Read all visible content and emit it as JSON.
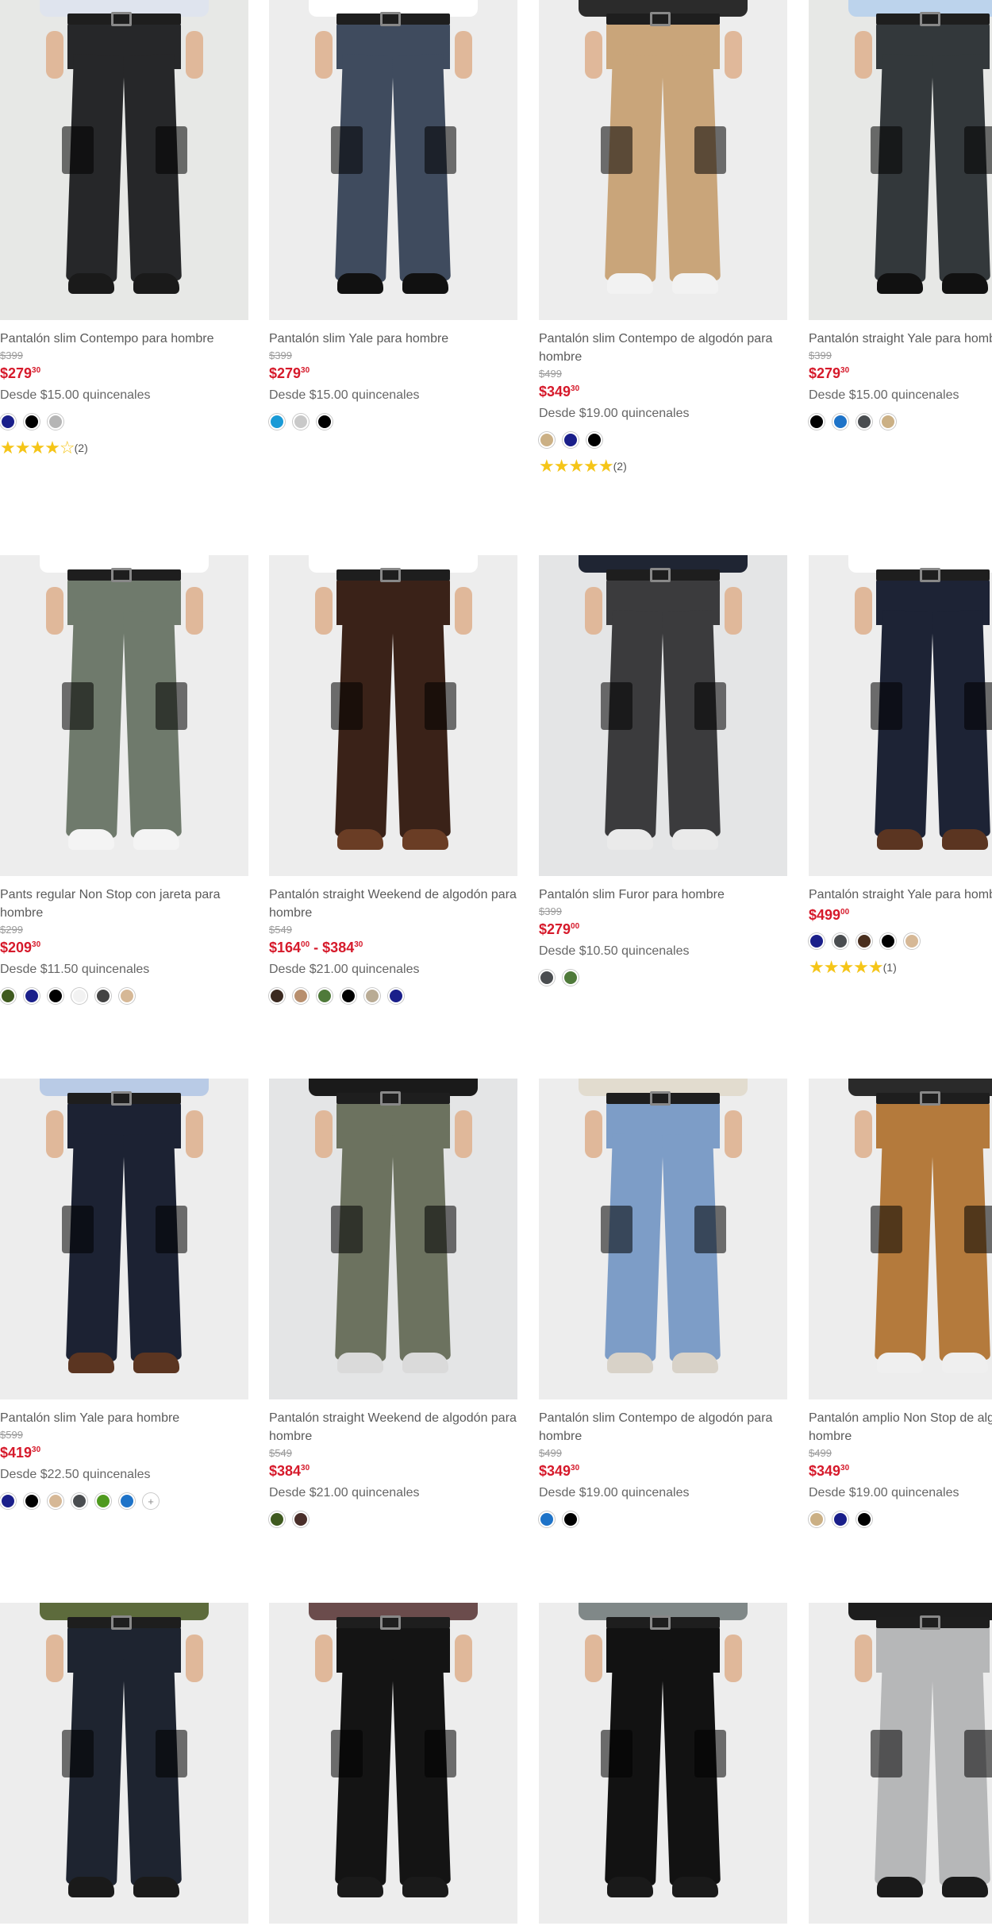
{
  "products": [
    {
      "title": "Pantalón slim Contempo para hombre",
      "old": "$399",
      "price": "$279",
      "cents": "30",
      "quin": "Desde $15.00 quincenales",
      "swatches": [
        "#1a1f8a",
        "#000000",
        "#b5b5b5"
      ],
      "stars": "★★★★☆",
      "reviews": "(2)",
      "pants": "#262729",
      "shirt": "#dfe4ee",
      "shoe": "#1a1a1a",
      "bg": "bg1"
    },
    {
      "title": "Pantalón slim Yale para hombre",
      "old": "$399",
      "price": "$279",
      "cents": "30",
      "quin": "Desde $15.00 quincenales",
      "swatches": [
        "#1a9ad6",
        "#c9c9c9",
        "#000000"
      ],
      "stars": "",
      "reviews": "",
      "pants": "#3f4b5e",
      "shirt": "#ffffff",
      "shoe": "#111111",
      "bg": "bg2"
    },
    {
      "title": "Pantalón slim Contempo de algodón para hombre",
      "old": "$499",
      "price": "$349",
      "cents": "30",
      "quin": "Desde $19.00 quincenales",
      "swatches": [
        "#cbb085",
        "#1a1f8a",
        "#000000"
      ],
      "stars": "★★★★★",
      "reviews": "(2)",
      "pants": "#c9a57a",
      "shirt": "#2b2b2b",
      "shoe": "#f2f2f2",
      "bg": "bg2"
    },
    {
      "title": "Pantalón straight Yale para hombre",
      "old": "$399",
      "price": "$279",
      "cents": "30",
      "quin": "Desde $15.00 quincenales",
      "swatches": [
        "#000000",
        "#1e73c8",
        "#4a4d50",
        "#cbb085"
      ],
      "stars": "",
      "reviews": "",
      "pants": "#33383b",
      "shirt": "#bcd3ec",
      "shoe": "#111111",
      "bg": "bg1"
    },
    {
      "title": "Pants regular Non Stop con jareta para hombre",
      "old": "$299",
      "price": "$209",
      "cents": "30",
      "quin": "Desde $11.50 quincenales",
      "swatches": [
        "#3f5a1f",
        "#1a1f8a",
        "#000000",
        "#f2f2f2",
        "#444444",
        "#d6b896"
      ],
      "stars": "",
      "reviews": "",
      "pants": "#6f7a6c",
      "shirt": "#ffffff",
      "shoe": "#f4f4f4",
      "bg": "bg2"
    },
    {
      "title": "Pantalón straight Weekend de algodón para hombre",
      "old": "$549",
      "price": "$164",
      "cents": "00",
      "range": " - $384",
      "rcents": "30",
      "quin": "Desde $21.00 quincenales",
      "swatches": [
        "#3b2a20",
        "#b88f6e",
        "#4f7a3a",
        "#000000",
        "#b9ab94",
        "#1a1f8a"
      ],
      "stars": "",
      "reviews": "",
      "pants": "#3a2218",
      "shirt": "#ffffff",
      "shoe": "#6a3d25",
      "bg": "bg2"
    },
    {
      "title": "Pantalón slim Furor para hombre",
      "old": "$399",
      "price": "$279",
      "cents": "00",
      "quin": "Desde $10.50 quincenales",
      "swatches": [
        "#4a4d50",
        "#4f7a3a"
      ],
      "stars": "",
      "reviews": "",
      "pants": "#3b3b3d",
      "shirt": "#1f2533",
      "shoe": "#eaeaea",
      "bg": "bg3"
    },
    {
      "title": "Pantalón straight Yale para hombre",
      "old": "",
      "price": "$499",
      "cents": "00",
      "quin": "",
      "swatches": [
        "#1a1f8a",
        "#4a4d50",
        "#4a2f1e",
        "#000000",
        "#d6b896"
      ],
      "stars": "★★★★★",
      "reviews": "(1)",
      "pants": "#1d2335",
      "shirt": "#ffffff",
      "shoe": "#5b3521",
      "bg": "bg2"
    },
    {
      "title": "Pantalón slim Yale para hombre",
      "old": "$599",
      "price": "$419",
      "cents": "30",
      "quin": "Desde $22.50 quincenales",
      "swatches": [
        "#1a1f8a",
        "#000000",
        "#d6b896",
        "#4a4d50",
        "#4f9a1f",
        "#1e73c8"
      ],
      "more": "+",
      "stars": "",
      "reviews": "",
      "pants": "#1c2233",
      "shirt": "#b9cbe6",
      "shoe": "#5b3521",
      "bg": "bg2"
    },
    {
      "title": "Pantalón straight Weekend de algodón para hombre",
      "old": "$549",
      "price": "$384",
      "cents": "30",
      "quin": "Desde $21.00 quincenales",
      "swatches": [
        "#3f5a1f",
        "#4a2f2a"
      ],
      "stars": "",
      "reviews": "",
      "pants": "#6c725f",
      "shirt": "#1a1a1a",
      "shoe": "#dadada",
      "bg": "bg3"
    },
    {
      "title": "Pantalón slim Contempo de algodón para hombre",
      "old": "$499",
      "price": "$349",
      "cents": "30",
      "quin": "Desde $19.00 quincenales",
      "swatches": [
        "#1e73c8",
        "#000000"
      ],
      "stars": "",
      "reviews": "",
      "pants": "#7d9dc7",
      "shirt": "#e2dccf",
      "shoe": "#d8d2c8",
      "bg": "bg2"
    },
    {
      "title": "Pantalón amplio Non Stop de algodón para hombre",
      "old": "$499",
      "price": "$349",
      "cents": "30",
      "quin": "Desde $19.00 quincenales",
      "swatches": [
        "#cbb085",
        "#1a1f8a",
        "#000000"
      ],
      "stars": "",
      "reviews": "",
      "pants": "#b47a3c",
      "shirt": "#2a2a2a",
      "shoe": "#efefef",
      "bg": "bg2"
    },
    {
      "title": "",
      "old": "",
      "price": "",
      "cents": "",
      "quin": "",
      "swatches": [],
      "stars": "",
      "reviews": "",
      "pants": "#1e2430",
      "shirt": "#5d6b3c",
      "shoe": "#1a1a1a",
      "bg": "bg2"
    },
    {
      "title": "",
      "old": "",
      "price": "",
      "cents": "",
      "quin": "",
      "swatches": [],
      "stars": "",
      "reviews": "",
      "pants": "#141414",
      "shirt": "#6b4c4c",
      "shoe": "#1a1a1a",
      "bg": "bg2"
    },
    {
      "title": "",
      "old": "",
      "price": "",
      "cents": "",
      "quin": "",
      "swatches": [],
      "stars": "",
      "reviews": "",
      "pants": "#121212",
      "shirt": "#808888",
      "shoe": "#1a1a1a",
      "bg": "bg2"
    },
    {
      "title": "",
      "old": "",
      "price": "",
      "cents": "",
      "quin": "",
      "swatches": [],
      "stars": "",
      "reviews": "",
      "pants": "#b6b7b8",
      "shirt": "#1d1d1d",
      "shoe": "#1a1a1a",
      "bg": "bg2"
    }
  ]
}
